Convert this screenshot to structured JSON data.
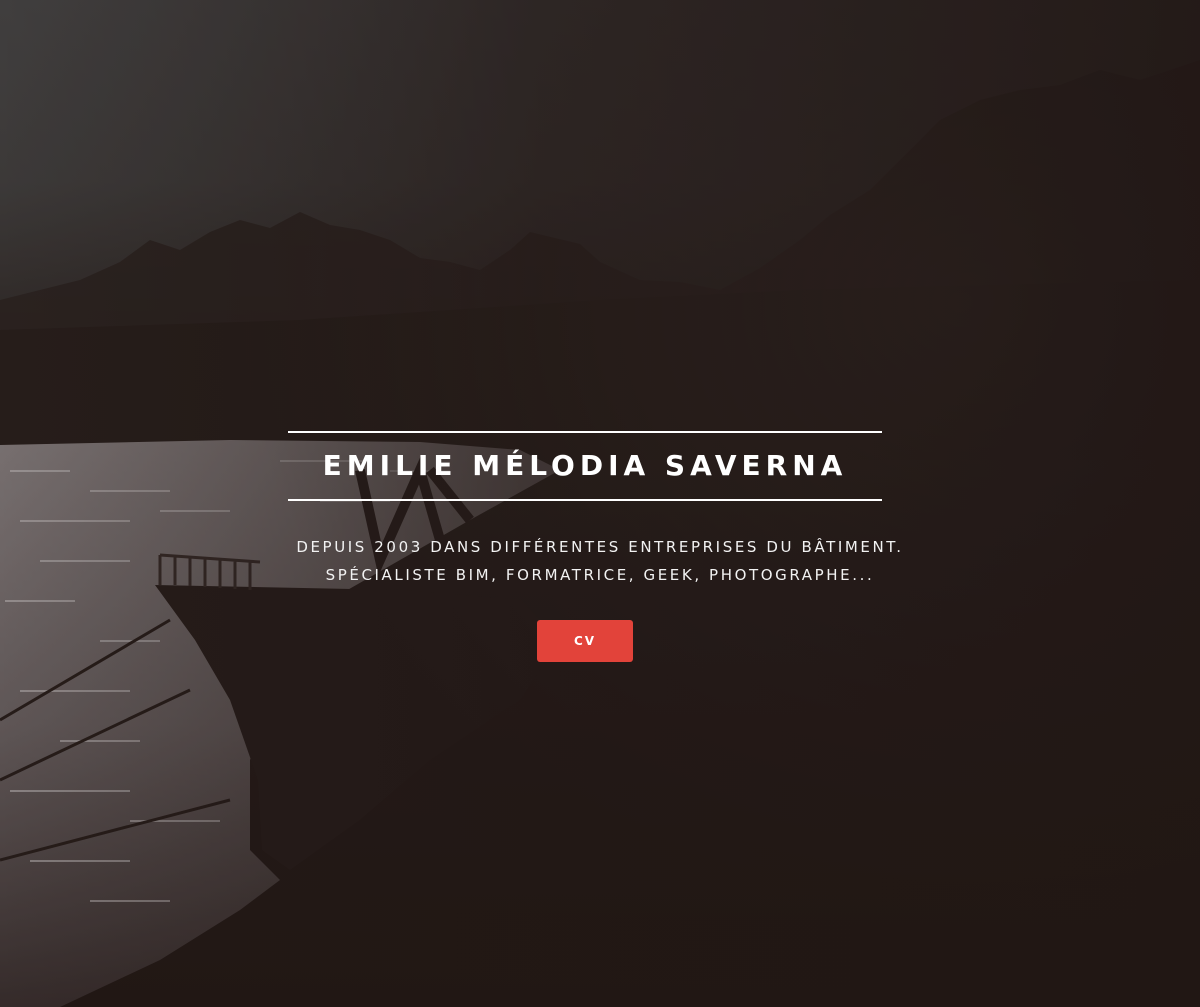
{
  "hero": {
    "background_image": "river-boat-silhouette-photo",
    "title": "EMILIE MÉLODIA SAVERNA",
    "subtitle_line1": "DEPUIS 2003 DANS DIFFÉRENTES ENTREPRISES DU BÂTIMENT.",
    "subtitle_line2": "SPÉCIALISTE BIM, FORMATRICE, GEEK, PHOTOGRAPHE...",
    "cv_button_label": "CV",
    "accent_color": "#e2433a",
    "text_color": "#ffffff"
  }
}
